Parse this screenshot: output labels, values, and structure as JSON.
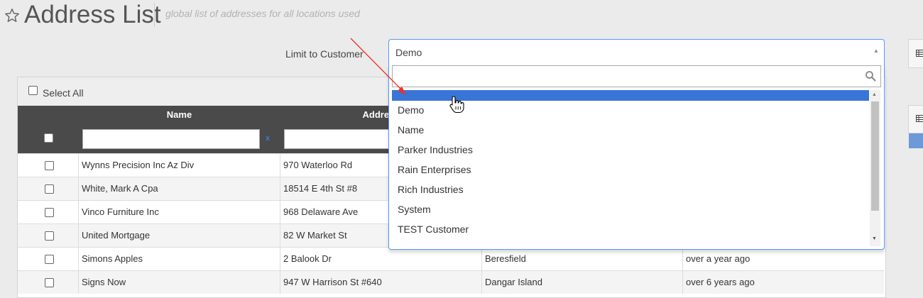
{
  "header": {
    "title": "Address List",
    "subtitle": "global list of addresses for all locations used"
  },
  "filter": {
    "limit_label": "Limit to Customer",
    "selected_value": "Demo",
    "search_value": "",
    "options": [
      "",
      "Demo",
      "Name",
      "Parker Industries",
      "Rain Enterprises",
      "Rich Industries",
      "System",
      "TEST Customer"
    ]
  },
  "table": {
    "select_all_label": "Select All",
    "columns": [
      "Name",
      "Address"
    ],
    "clear_symbol": "x",
    "rows": [
      {
        "name": "Wynns Precision Inc Az Div",
        "address": "970 Waterloo Rd",
        "city": "",
        "updated": ""
      },
      {
        "name": "White, Mark A Cpa",
        "address": "18514 E 4th St #8",
        "city": "",
        "updated": ""
      },
      {
        "name": "Vinco Furniture Inc",
        "address": "968 Delaware Ave",
        "city": "",
        "updated": ""
      },
      {
        "name": "United Mortgage",
        "address": "82 W Market St",
        "city": "",
        "updated": ""
      },
      {
        "name": "Simons Apples",
        "address": "2 Balook Dr",
        "city": "Beresfield",
        "updated": "over a year ago"
      },
      {
        "name": "Signs Now",
        "address": "947 W Harrison St #640",
        "city": "Dangar Island",
        "updated": "over 6 years ago"
      }
    ]
  },
  "colors": {
    "accent": "#3875d7",
    "header_bg": "#4a4a4a",
    "annotation": "#e8322a"
  },
  "icons": {
    "title": "star-icon",
    "search": "search-icon",
    "cursor": "hand-cursor-icon",
    "widgets": "grid-icon"
  }
}
